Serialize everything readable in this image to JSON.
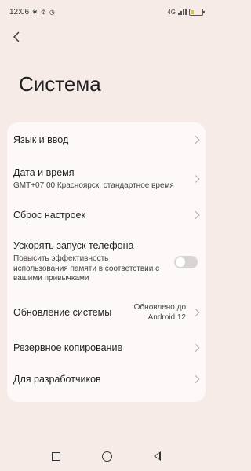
{
  "status": {
    "time": "12:06",
    "icons": [
      "bluetooth-icon",
      "gear-icon",
      "timer-icon"
    ],
    "network": "4G",
    "battery_level": 0.3
  },
  "header": {
    "back_icon": "chevron-left-icon",
    "title": "Система"
  },
  "settings": {
    "language": {
      "label": "Язык и ввод"
    },
    "datetime": {
      "label": "Дата и время",
      "sub": "GMT+07:00 Красноярск, стандартное время"
    },
    "reset": {
      "label": "Сброс настроек"
    },
    "boost": {
      "label": "Ускорять запуск телефона",
      "sub": "Повысить эффективность использования памяти в соответствии с вашими привычками",
      "enabled": false
    },
    "update": {
      "label": "Обновление системы",
      "value_line1": "Обновлено до",
      "value_line2": "Android 12"
    },
    "backup": {
      "label": "Резервное копирование"
    },
    "developer": {
      "label": "Для разработчиков"
    }
  },
  "nav": {
    "recent": "square-icon",
    "home": "circle-icon",
    "back": "triangle-back-icon"
  },
  "colors": {
    "background": "#f7ebe8",
    "card": "#fdf9f8",
    "text": "#1f1f1f",
    "toggle_off": "#d9d5d4"
  }
}
